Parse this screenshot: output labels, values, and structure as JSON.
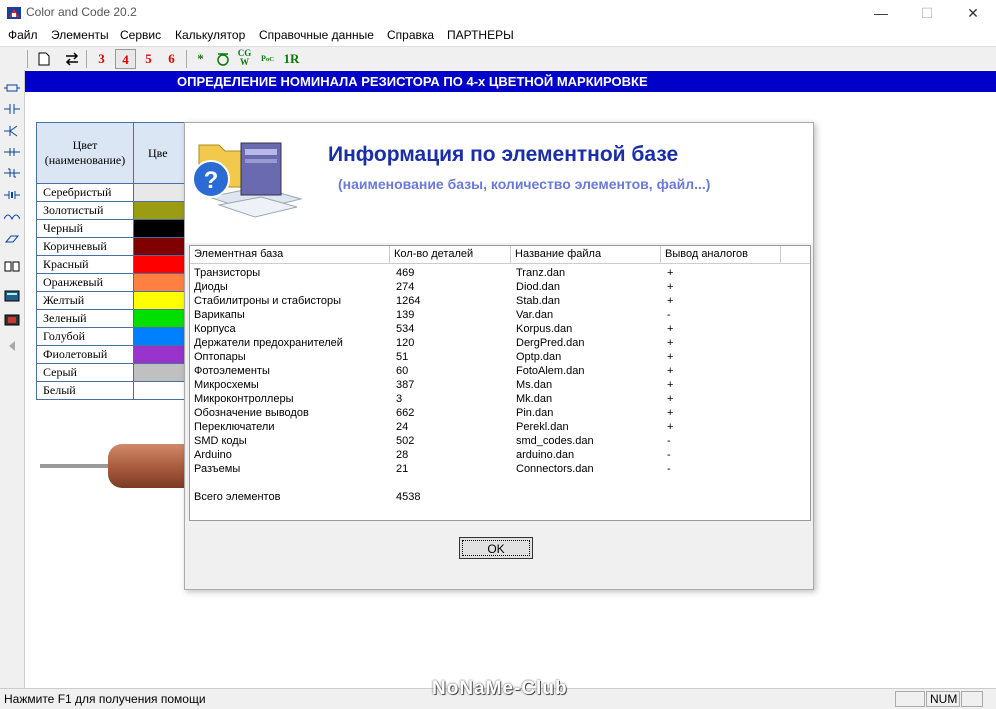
{
  "window": {
    "title": "Color and Code 20.2",
    "minimize": "—",
    "maximize": "☐",
    "close": "✕"
  },
  "menu": [
    "Файл",
    "Элементы",
    "Сервис",
    "Калькулятор",
    "Справочные данные",
    "Справка",
    "ПАРТНЕРЫ"
  ],
  "toolbar": {
    "band3": "3",
    "band4": "4",
    "band5": "5",
    "band6": "6",
    "star": "*",
    "ir": "1R",
    "cg": "CG"
  },
  "banner": "ОПРЕДЕЛЕНИЕ НОМИНАЛА РЕЗИСТОРА ПО 4-х ЦВЕТНОЙ МАРКИРОВКЕ",
  "color_table": {
    "header": "Цвет (наименование)",
    "header2": "Цве",
    "rows": [
      {
        "name": "Серебристый",
        "swatch": "#e8e8e8"
      },
      {
        "name": "Золотистый",
        "swatch": "#9c9c12"
      },
      {
        "name": "Черный",
        "swatch": "#000000"
      },
      {
        "name": "Коричневый",
        "swatch": "#800000"
      },
      {
        "name": "Красный",
        "swatch": "#ff0000"
      },
      {
        "name": "Оранжевый",
        "swatch": "#ff8040"
      },
      {
        "name": "Желтый",
        "swatch": "#ffff00"
      },
      {
        "name": "Зеленый",
        "swatch": "#00e000"
      },
      {
        "name": "Голубой",
        "swatch": "#0080ff"
      },
      {
        "name": "Фиолетовый",
        "swatch": "#9933cc"
      },
      {
        "name": "Серый",
        "swatch": "#c0c0c0"
      },
      {
        "name": "Белый",
        "swatch": "#ffffff"
      }
    ]
  },
  "dialog": {
    "title": "Информация по элементной базе",
    "subtitle": "(наименование базы, количество элементов, файл...)",
    "columns": [
      "Элементная база",
      "Кол-во деталей",
      "Название файла",
      "Вывод аналогов"
    ],
    "rows": [
      {
        "base": "Транзисторы",
        "count": "469",
        "file": "Tranz.dan",
        "analog": "+"
      },
      {
        "base": "Диоды",
        "count": "274",
        "file": "Diod.dan",
        "analog": "+"
      },
      {
        "base": "Стабилитроны и стабисторы",
        "count": "1264",
        "file": "Stab.dan",
        "analog": "+"
      },
      {
        "base": "Варикапы",
        "count": "139",
        "file": "Var.dan",
        "analog": "-"
      },
      {
        "base": "Корпуса",
        "count": "534",
        "file": "Korpus.dan",
        "analog": "+"
      },
      {
        "base": "Держатели предохранителей",
        "count": "120",
        "file": "DergPred.dan",
        "analog": "+"
      },
      {
        "base": "Оптопары",
        "count": "51",
        "file": "Optp.dan",
        "analog": "+"
      },
      {
        "base": "Фотоэлементы",
        "count": "60",
        "file": "FotoAlem.dan",
        "analog": "+"
      },
      {
        "base": "Микросхемы",
        "count": "387",
        "file": "Ms.dan",
        "analog": "+"
      },
      {
        "base": "Микроконтроллеры",
        "count": "3",
        "file": "Mk.dan",
        "analog": "+"
      },
      {
        "base": "Обозначение выводов",
        "count": "662",
        "file": "Pin.dan",
        "analog": "+"
      },
      {
        "base": "Переключатели",
        "count": "24",
        "file": "Perekl.dan",
        "analog": "+"
      },
      {
        "base": "SMD коды",
        "count": "502",
        "file": "smd_codes.dan",
        "analog": "-"
      },
      {
        "base": "Arduino",
        "count": "28",
        "file": "arduino.dan",
        "analog": "-"
      },
      {
        "base": "Разъемы",
        "count": "21",
        "file": "Connectors.dan",
        "analog": "-"
      }
    ],
    "total_label": "Всего элементов",
    "total_value": "4538",
    "ok": "OK"
  },
  "status": {
    "help": "Нажмите F1 для получения помощи",
    "num": "NUM"
  },
  "watermark": "NoNaMe-Club"
}
